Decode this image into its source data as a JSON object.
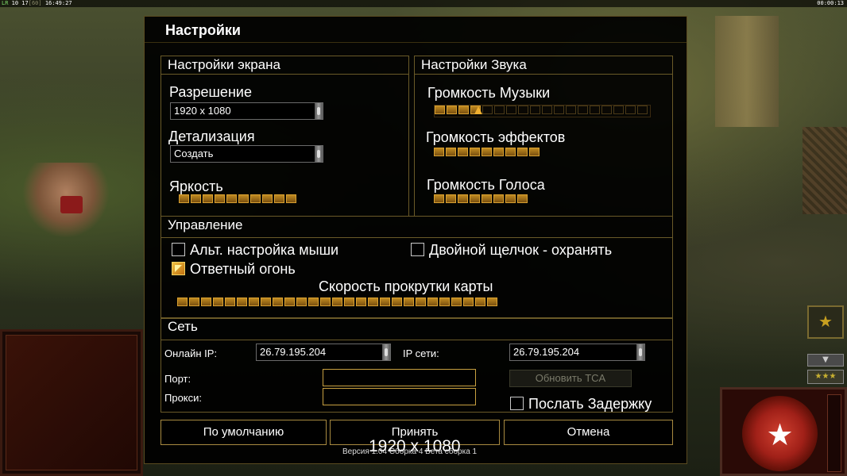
{
  "hud": {
    "top_left_prefix": "LR",
    "top_left_counts": "10 17",
    "top_left_fps": "[60]",
    "top_left_clock": "16:49:27",
    "top_right_timer": "00:00:13"
  },
  "dialog": {
    "title": "Настройки",
    "display": {
      "title": "Настройки экрана",
      "resolution_label": "Разрешение",
      "resolution_value": "1920 x 1080",
      "detail_label": "Детализация",
      "detail_value": "Создать",
      "brightness_label": "Яркость",
      "brightness_level": 0.5
    },
    "sound": {
      "title": "Настройки Звука",
      "music_label": "Громкость Музыки",
      "music_level": 0.2,
      "effects_label": "Громкость эффектов",
      "effects_level": 0.5,
      "voice_label": "Громкость Голоса",
      "voice_level": 0.4
    },
    "controls": {
      "title": "Управление",
      "alt_mouse_label": "Альт. настройка мыши",
      "alt_mouse_checked": false,
      "double_click_label": "Двойной щелчок - охранять",
      "double_click_checked": false,
      "retaliation_label": "Ответный огонь",
      "retaliation_checked": true,
      "scroll_label": "Скорость прокрутки карты",
      "scroll_level": 1.0
    },
    "network": {
      "title": "Сеть",
      "online_ip_label": "Онлайн IP:",
      "online_ip_value": "26.79.195.204",
      "lan_ip_label": "IP сети:",
      "lan_ip_value": "26.79.195.204",
      "port_label": "Порт:",
      "port_value": "",
      "proxy_label": "Прокси:",
      "proxy_value": "",
      "update_tca_label": "Обновить TCA",
      "send_delay_label": "Послать Задержку",
      "send_delay_checked": false
    },
    "buttons": {
      "default_label": "По умолчанию",
      "accept_label": "Принять",
      "cancel_label": "Отмена"
    },
    "overlay_resolution": "1920 x 1080",
    "version_text": "Версия 1.04 Сборка 4 Бета сборка 1"
  }
}
